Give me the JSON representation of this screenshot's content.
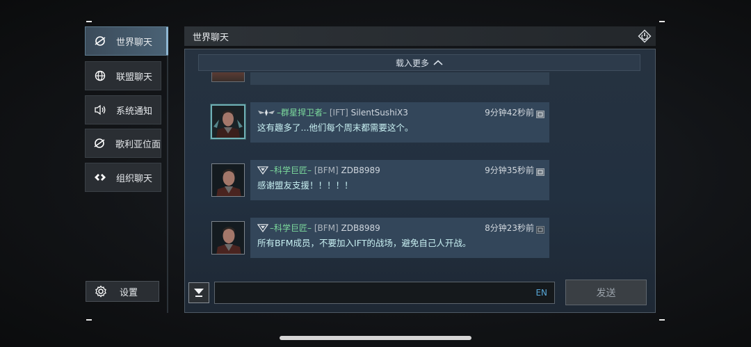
{
  "sidebar": {
    "items": [
      {
        "label": "世界聊天",
        "icon": "world-chat-icon",
        "active": true
      },
      {
        "label": "联盟聊天",
        "icon": "globe-icon",
        "active": false
      },
      {
        "label": "系统通知",
        "icon": "speaker-icon",
        "active": false
      },
      {
        "label": "歌利亚位面",
        "icon": "world-chat-icon",
        "active": false
      },
      {
        "label": "组织聊天",
        "icon": "organization-icon",
        "active": false
      }
    ],
    "settings_label": "设置"
  },
  "header": {
    "title": "世界聊天"
  },
  "chat": {
    "load_more": "载入更多",
    "messages": [
      {
        "alliance": "–群星捍卫者–",
        "tag": "[IFT]",
        "user": "SilentSushiX3",
        "time": "9分钟42秒前",
        "text": "这有趣多了...他们每个周末都需要这个。"
      },
      {
        "alliance": "–科学巨匠–",
        "tag": "[BFM]",
        "user": "ZDB8989",
        "time": "9分钟35秒前",
        "text": "感谢盟友支援！！！！！"
      },
      {
        "alliance": "–科学巨匠–",
        "tag": "[BFM]",
        "user": "ZDB8989",
        "time": "8分钟23秒前",
        "text": "所有BFM成员，不要加入IFT的战场，避免自己人开战。"
      }
    ]
  },
  "input": {
    "value": "",
    "lang": "EN",
    "send_label": "发送"
  },
  "colors": {
    "accent": "#8fb7d3",
    "alliance_green": "#7ddc9d",
    "message_cyan": "#c8f0f2",
    "lang_blue": "#57a6d6"
  }
}
